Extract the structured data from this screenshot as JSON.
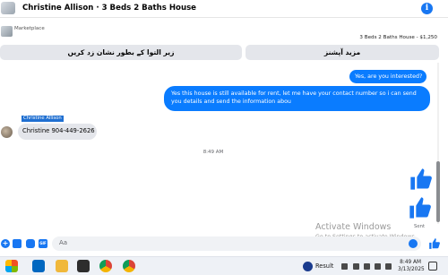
{
  "header": {
    "title": "Christine Allison · 3 Beds 2 Baths House",
    "info_icon_glyph": "i",
    "info_icon_color": "#1877f2"
  },
  "listing": {
    "marketplace_label": "Marketplace",
    "price_line": "3 Beds 2 Baths House - $1,250"
  },
  "actions": {
    "left_button": "زیر التوا کے بطور نشان زد کریں",
    "right_button": "مزید آپشنز"
  },
  "messages": [
    {
      "direction": "outgoing",
      "text": "Yes, are you interested?"
    },
    {
      "direction": "outgoing",
      "text": "Yes this house is still available for rent, let me have your contact number so i can send you details and send the information abou"
    },
    {
      "direction": "incoming",
      "sender": "Christine Allison",
      "text": "Christine 904-449-2626"
    }
  ],
  "time_separator": "8:49 AM",
  "sent_status": "Sent",
  "watermark": {
    "line1": "Activate Windows",
    "line2": "Go to Settings to activate Windows."
  },
  "composer": {
    "placeholder": "Aa",
    "icons": [
      "plus-icon",
      "image-icon",
      "sticker-icon",
      "gif-icon",
      "emoji-icon",
      "like-icon"
    ],
    "gif_label": "GIF"
  },
  "taskbar": {
    "result_label": "Result",
    "time": "8:49 AM",
    "date": "3/13/2025"
  },
  "colors": {
    "accent": "#0a7cff",
    "incoming_bubble": "#e4e6eb",
    "like": "#1877f2"
  }
}
